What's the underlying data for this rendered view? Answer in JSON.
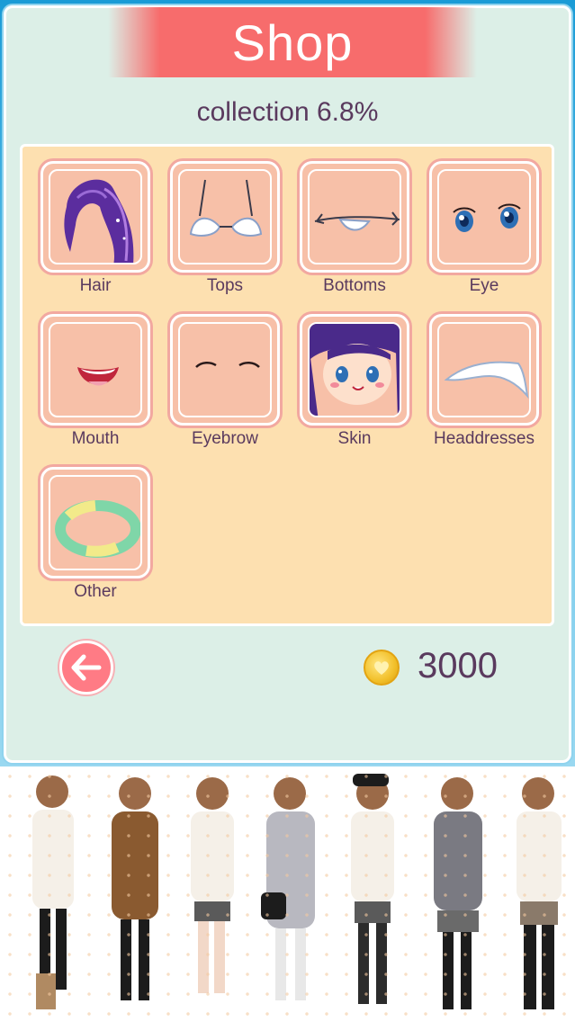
{
  "header": {
    "title": "Shop"
  },
  "collection_text": "collection 6.8%",
  "categories": [
    {
      "label": "Hair",
      "icon": "hair-icon"
    },
    {
      "label": "Tops",
      "icon": "tops-icon"
    },
    {
      "label": "Bottoms",
      "icon": "bottoms-icon"
    },
    {
      "label": "Eye",
      "icon": "eye-icon"
    },
    {
      "label": "Mouth",
      "icon": "mouth-icon"
    },
    {
      "label": "Eyebrow",
      "icon": "eyebrow-icon"
    },
    {
      "label": "Skin",
      "icon": "skin-icon"
    },
    {
      "label": "Headdresses",
      "icon": "headdress-icon"
    },
    {
      "label": "Other",
      "icon": "bracelet-icon"
    }
  ],
  "footer": {
    "back_icon": "back-arrow-icon",
    "coin_icon": "heart-coin-icon",
    "coins": "3000"
  },
  "colors": {
    "accent": "#f76c6c",
    "panel_bg": "#dcefe7",
    "grid_bg": "#fde0b0",
    "tile_bg": "#f7c0a8",
    "text": "#5a3a5e"
  }
}
